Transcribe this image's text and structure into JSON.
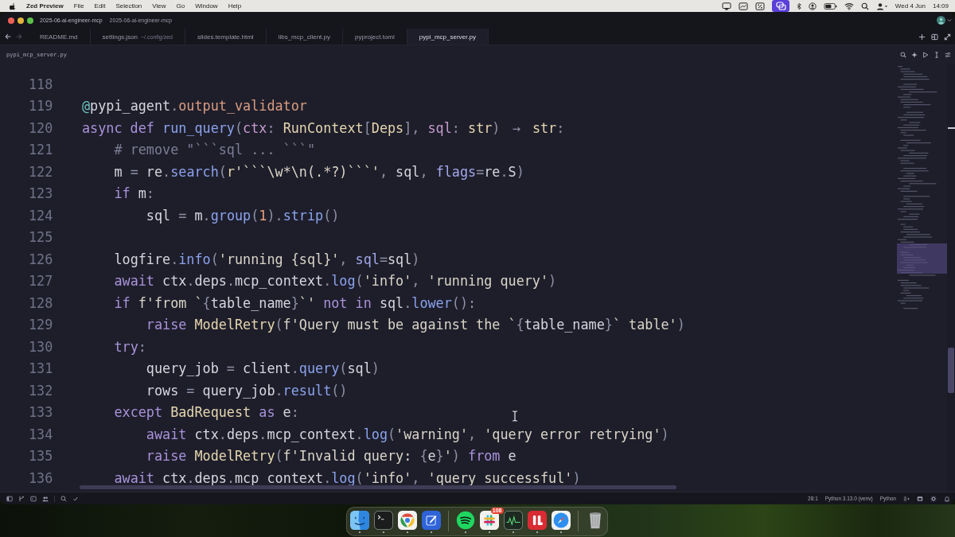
{
  "menu_bar": {
    "app_name": "Zed Preview",
    "items": [
      "File",
      "Edit",
      "Selection",
      "View",
      "Go",
      "Window",
      "Help"
    ],
    "date": "Wed 4 Jun",
    "time": "14:09"
  },
  "window": {
    "title_items": [
      "2025-06-ai-engineer-mcp",
      "2025-06-ai-engineer-mcp"
    ]
  },
  "nav": {
    "back": {
      "disabled": false
    },
    "forward": {
      "disabled": true
    }
  },
  "tabs": [
    {
      "label": "README.md",
      "selected": false
    },
    {
      "label": "settings.json",
      "detail": "~/.config/zed",
      "selected": false
    },
    {
      "label": "slides.template.html",
      "selected": false
    },
    {
      "label": "libs_mcp_client.py",
      "selected": false
    },
    {
      "label": "pyproject.toml",
      "selected": false
    },
    {
      "label": "pypi_mcp_server.py",
      "selected": true
    }
  ],
  "breadcrumb": "pypi_mcp_server.py",
  "editor": {
    "lines": [
      {
        "number": "118"
      },
      {
        "number": "119",
        "tokens": [
          {
            "text": "@",
            "kind": "decorator"
          },
          {
            "text": "pypi_agent",
            "kind": "variable"
          },
          {
            "text": ".",
            "kind": "punctuation"
          },
          {
            "text": "output_validator",
            "kind": "attribute"
          }
        ]
      },
      {
        "number": "120",
        "tokens": [
          {
            "text": "async def ",
            "kind": "keyword"
          },
          {
            "text": "run_query",
            "kind": "function"
          },
          {
            "text": "(",
            "kind": "punctuation"
          },
          {
            "text": "ctx",
            "kind": "parameter"
          },
          {
            "text": ": ",
            "kind": "punctuation"
          },
          {
            "text": "RunContext",
            "kind": "type"
          },
          {
            "text": "[",
            "kind": "punctuation"
          },
          {
            "text": "Deps",
            "kind": "type"
          },
          {
            "text": "], ",
            "kind": "punctuation"
          },
          {
            "text": "sql",
            "kind": "parameter"
          },
          {
            "text": ": ",
            "kind": "punctuation"
          },
          {
            "text": "str",
            "kind": "type"
          },
          {
            "text": ") ",
            "kind": "punctuation"
          },
          {
            "text": "→",
            "kind": "ligature"
          },
          {
            "text": " str",
            "kind": "type"
          },
          {
            "text": ":",
            "kind": "punctuation"
          }
        ]
      },
      {
        "number": "121",
        "tokens": [
          {
            "text": "    # remove \"```sql ... ```\"",
            "kind": "comment"
          }
        ]
      },
      {
        "number": "122",
        "tokens": [
          {
            "text": "    m",
            "kind": "variable"
          },
          {
            "text": " = ",
            "kind": "punctuation"
          },
          {
            "text": "re",
            "kind": "variable"
          },
          {
            "text": ".",
            "kind": "punctuation"
          },
          {
            "text": "search",
            "kind": "function"
          },
          {
            "text": "(",
            "kind": "punctuation"
          },
          {
            "text": "r",
            "kind": "type"
          },
          {
            "text": "'```\\w*\\n(.*?)```'",
            "kind": "string"
          },
          {
            "text": ", ",
            "kind": "punctuation"
          },
          {
            "text": "sql",
            "kind": "variable"
          },
          {
            "text": ", ",
            "kind": "punctuation"
          },
          {
            "text": "flags",
            "kind": "argument"
          },
          {
            "text": "=",
            "kind": "punctuation"
          },
          {
            "text": "re",
            "kind": "variable"
          },
          {
            "text": ".",
            "kind": "punctuation"
          },
          {
            "text": "S",
            "kind": "variable"
          },
          {
            "text": ")",
            "kind": "punctuation"
          }
        ]
      },
      {
        "number": "123",
        "tokens": [
          {
            "text": "    if",
            "kind": "keyword"
          },
          {
            "text": " m",
            "kind": "variable"
          },
          {
            "text": ":",
            "kind": "punctuation"
          }
        ]
      },
      {
        "number": "124",
        "tokens": [
          {
            "text": "        sql",
            "kind": "variable"
          },
          {
            "text": " = ",
            "kind": "punctuation"
          },
          {
            "text": "m",
            "kind": "variable"
          },
          {
            "text": ".",
            "kind": "punctuation"
          },
          {
            "text": "group",
            "kind": "function"
          },
          {
            "text": "(",
            "kind": "punctuation"
          },
          {
            "text": "1",
            "kind": "number"
          },
          {
            "text": ").",
            "kind": "punctuation"
          },
          {
            "text": "strip",
            "kind": "function"
          },
          {
            "text": "()",
            "kind": "punctuation"
          }
        ]
      },
      {
        "number": "125"
      },
      {
        "number": "126",
        "tokens": [
          {
            "text": "    logfire",
            "kind": "variable"
          },
          {
            "text": ".",
            "kind": "punctuation"
          },
          {
            "text": "info",
            "kind": "function"
          },
          {
            "text": "(",
            "kind": "punctuation"
          },
          {
            "text": "'running {sql}'",
            "kind": "string"
          },
          {
            "text": ", ",
            "kind": "punctuation"
          },
          {
            "text": "sql",
            "kind": "argument"
          },
          {
            "text": "=",
            "kind": "punctuation"
          },
          {
            "text": "sql",
            "kind": "variable"
          },
          {
            "text": ")",
            "kind": "punctuation"
          }
        ]
      },
      {
        "number": "127",
        "tokens": [
          {
            "text": "    await",
            "kind": "keyword"
          },
          {
            "text": " ctx",
            "kind": "variable"
          },
          {
            "text": ".",
            "kind": "punctuation"
          },
          {
            "text": "deps",
            "kind": "variable"
          },
          {
            "text": ".",
            "kind": "punctuation"
          },
          {
            "text": "mcp_context",
            "kind": "variable"
          },
          {
            "text": ".",
            "kind": "punctuation"
          },
          {
            "text": "log",
            "kind": "function"
          },
          {
            "text": "(",
            "kind": "punctuation"
          },
          {
            "text": "'info'",
            "kind": "string"
          },
          {
            "text": ", ",
            "kind": "punctuation"
          },
          {
            "text": "'running query'",
            "kind": "string"
          },
          {
            "text": ")",
            "kind": "punctuation"
          }
        ]
      },
      {
        "number": "128",
        "tokens": [
          {
            "text": "    if",
            "kind": "keyword"
          },
          {
            "text": " f'from `",
            "kind": "string"
          },
          {
            "text": "{",
            "kind": "punctuation"
          },
          {
            "text": "table_name",
            "kind": "variable"
          },
          {
            "text": "}",
            "kind": "punctuation"
          },
          {
            "text": "`'",
            "kind": "string"
          },
          {
            "text": " not in ",
            "kind": "keyword"
          },
          {
            "text": "sql",
            "kind": "variable"
          },
          {
            "text": ".",
            "kind": "punctuation"
          },
          {
            "text": "lower",
            "kind": "function"
          },
          {
            "text": "():",
            "kind": "punctuation"
          }
        ]
      },
      {
        "number": "129",
        "tokens": [
          {
            "text": "        raise",
            "kind": "keyword"
          },
          {
            "text": " ModelRetry",
            "kind": "type"
          },
          {
            "text": "(",
            "kind": "punctuation"
          },
          {
            "text": "f'Query must be against the `",
            "kind": "string"
          },
          {
            "text": "{",
            "kind": "punctuation"
          },
          {
            "text": "table_name",
            "kind": "variable"
          },
          {
            "text": "}",
            "kind": "punctuation"
          },
          {
            "text": "` table'",
            "kind": "string"
          },
          {
            "text": ")",
            "kind": "punctuation"
          }
        ]
      },
      {
        "number": "130",
        "tokens": [
          {
            "text": "    try",
            "kind": "keyword"
          },
          {
            "text": ":",
            "kind": "punctuation"
          }
        ]
      },
      {
        "number": "131",
        "tokens": [
          {
            "text": "        query_job",
            "kind": "variable"
          },
          {
            "text": " = ",
            "kind": "punctuation"
          },
          {
            "text": "client",
            "kind": "variable"
          },
          {
            "text": ".",
            "kind": "punctuation"
          },
          {
            "text": "query",
            "kind": "function"
          },
          {
            "text": "(",
            "kind": "punctuation"
          },
          {
            "text": "sql",
            "kind": "variable"
          },
          {
            "text": ")",
            "kind": "punctuation"
          }
        ]
      },
      {
        "number": "132",
        "tokens": [
          {
            "text": "        rows",
            "kind": "variable"
          },
          {
            "text": " = ",
            "kind": "punctuation"
          },
          {
            "text": "query_job",
            "kind": "variable"
          },
          {
            "text": ".",
            "kind": "punctuation"
          },
          {
            "text": "result",
            "kind": "function"
          },
          {
            "text": "()",
            "kind": "punctuation"
          }
        ]
      },
      {
        "number": "133",
        "tokens": [
          {
            "text": "    except",
            "kind": "keyword"
          },
          {
            "text": " BadRequest",
            "kind": "type"
          },
          {
            "text": " as ",
            "kind": "keyword"
          },
          {
            "text": "e",
            "kind": "variable"
          },
          {
            "text": ":",
            "kind": "punctuation"
          }
        ]
      },
      {
        "number": "134",
        "tokens": [
          {
            "text": "        await",
            "kind": "keyword"
          },
          {
            "text": " ctx",
            "kind": "variable"
          },
          {
            "text": ".",
            "kind": "punctuation"
          },
          {
            "text": "deps",
            "kind": "variable"
          },
          {
            "text": ".",
            "kind": "punctuation"
          },
          {
            "text": "mcp_context",
            "kind": "variable"
          },
          {
            "text": ".",
            "kind": "punctuation"
          },
          {
            "text": "log",
            "kind": "function"
          },
          {
            "text": "(",
            "kind": "punctuation"
          },
          {
            "text": "'warning'",
            "kind": "string"
          },
          {
            "text": ", ",
            "kind": "punctuation"
          },
          {
            "text": "'query error retrying'",
            "kind": "string"
          },
          {
            "text": ")",
            "kind": "punctuation"
          }
        ]
      },
      {
        "number": "135",
        "tokens": [
          {
            "text": "        raise",
            "kind": "keyword"
          },
          {
            "text": " ModelRetry",
            "kind": "type"
          },
          {
            "text": "(",
            "kind": "punctuation"
          },
          {
            "text": "f'Invalid query: ",
            "kind": "string"
          },
          {
            "text": "{",
            "kind": "punctuation"
          },
          {
            "text": "e",
            "kind": "variable"
          },
          {
            "text": "}",
            "kind": "punctuation"
          },
          {
            "text": "'",
            "kind": "string"
          },
          {
            "text": ")",
            "kind": "punctuation"
          },
          {
            "text": " from ",
            "kind": "keyword"
          },
          {
            "text": "e",
            "kind": "variable"
          }
        ]
      },
      {
        "number": "136",
        "tokens": [
          {
            "text": "    await",
            "kind": "keyword"
          },
          {
            "text": " ctx",
            "kind": "variable"
          },
          {
            "text": ".",
            "kind": "punctuation"
          },
          {
            "text": "deps",
            "kind": "variable"
          },
          {
            "text": ".",
            "kind": "punctuation"
          },
          {
            "text": "mcp_context",
            "kind": "variable"
          },
          {
            "text": ".",
            "kind": "punctuation"
          },
          {
            "text": "log",
            "kind": "function"
          },
          {
            "text": "(",
            "kind": "punctuation"
          },
          {
            "text": "'info'",
            "kind": "string"
          },
          {
            "text": ", ",
            "kind": "punctuation"
          },
          {
            "text": "'query successful'",
            "kind": "string"
          },
          {
            "text": ")",
            "kind": "punctuation"
          }
        ]
      }
    ]
  },
  "status_bar": {
    "cursor": "28:1",
    "interpreter": "Python 3.13.0 (venv)",
    "language": "Python"
  },
  "dock": {
    "apps": [
      {
        "running": true
      },
      {
        "running": true
      },
      {
        "running": true
      },
      {
        "running": true
      },
      {
        "running": true
      },
      {
        "running": true,
        "badge": "108"
      },
      {
        "running": true
      },
      {
        "running": true
      },
      {
        "running": true
      },
      {
        "running": false
      }
    ]
  }
}
